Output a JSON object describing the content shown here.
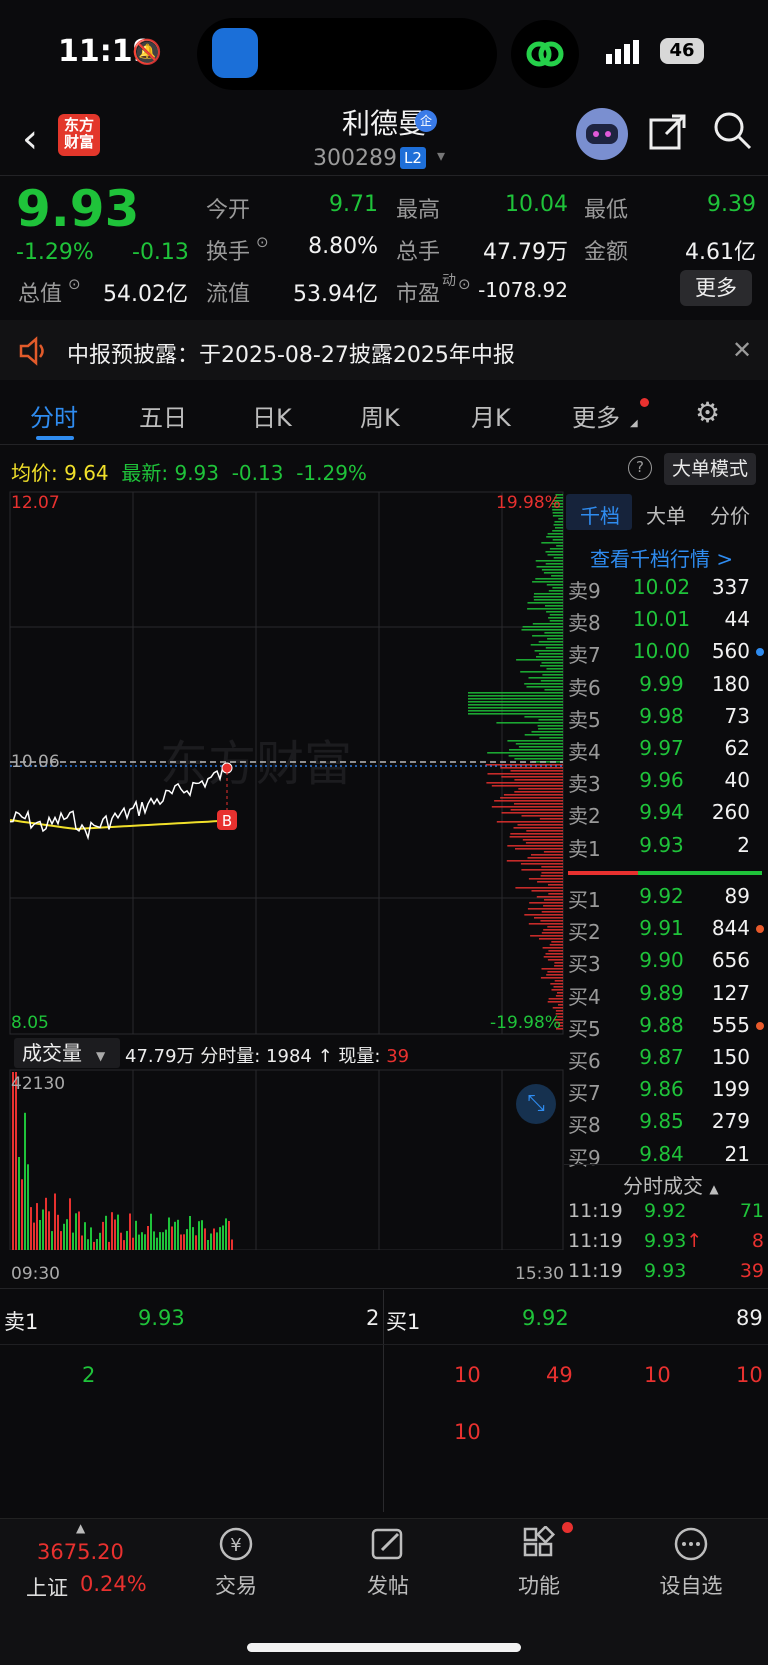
{
  "status_bar": {
    "time": "11:19",
    "battery": "46"
  },
  "header": {
    "logo_text": "东方财富",
    "stock_name": "利德曼",
    "enterprise_badge": "企",
    "stock_code": "300289",
    "level_badge": "L2"
  },
  "quote": {
    "price": "9.93",
    "change_pct": "-1.29%",
    "change": "-0.13",
    "fields": [
      {
        "label": "今开",
        "value": "9.71",
        "color": "green"
      },
      {
        "label": "最高",
        "value": "10.04",
        "color": "green"
      },
      {
        "label": "最低",
        "value": "9.39",
        "color": "green"
      },
      {
        "label": "换手",
        "value": "8.80%",
        "color": "white"
      },
      {
        "label": "总手",
        "value": "47.79万",
        "color": "white"
      },
      {
        "label": "金额",
        "value": "4.61亿",
        "color": "white"
      },
      {
        "label": "总值",
        "value": "54.02亿",
        "color": "white"
      },
      {
        "label": "流值",
        "value": "53.94亿",
        "color": "white"
      },
      {
        "label": "市盈",
        "label_sup": "动",
        "value": "-1078.92",
        "color": "white"
      }
    ],
    "more_button": "更多"
  },
  "notice": {
    "text": "中报预披露：于2025-08-27披露2025年中报"
  },
  "tabs": [
    "分时",
    "五日",
    "日K",
    "周K",
    "月K",
    "更多"
  ],
  "avg_row": {
    "avg_label": "均价:",
    "avg_value": "9.64",
    "latest_label": "最新:",
    "latest_value": "9.93",
    "latest_change": "-0.13",
    "latest_pct": "-1.29%",
    "help": "?",
    "big_order_button": "大单模式"
  },
  "chart": {
    "price_top": "12.07",
    "pct_top": "19.98%",
    "prev_close": "10.06",
    "price_bottom": "8.05",
    "pct_bottom": "-19.98%",
    "watermark": "东方财富",
    "buy_marker": "B",
    "volume_select": "成交量",
    "volume_info_total": "47.79万",
    "volume_info_label": "分时量: 1984 ↑ 现量:",
    "volume_info_now": "39",
    "volume_max": "42130",
    "time_start": "09:30",
    "time_end": "15:30",
    "colors": {
      "up": "#e8312f",
      "down": "#1fc33a",
      "avg": "#f1e02a",
      "price": "#ffffff"
    }
  },
  "orderbook": {
    "tabs": [
      "千档",
      "大单",
      "分价"
    ],
    "link": "查看千档行情 >",
    "asks": [
      {
        "label": "卖9",
        "price": "10.02",
        "vol": "337",
        "dot": ""
      },
      {
        "label": "卖8",
        "price": "10.01",
        "vol": "44",
        "dot": ""
      },
      {
        "label": "卖7",
        "price": "10.00",
        "vol": "560",
        "dot": "#2f8cf0"
      },
      {
        "label": "卖6",
        "price": "9.99",
        "vol": "180",
        "dot": ""
      },
      {
        "label": "卖5",
        "price": "9.98",
        "vol": "73",
        "dot": ""
      },
      {
        "label": "卖4",
        "price": "9.97",
        "vol": "62",
        "dot": ""
      },
      {
        "label": "卖3",
        "price": "9.96",
        "vol": "40",
        "dot": ""
      },
      {
        "label": "卖2",
        "price": "9.94",
        "vol": "260",
        "dot": ""
      },
      {
        "label": "卖1",
        "price": "9.93",
        "vol": "2",
        "dot": ""
      }
    ],
    "bids": [
      {
        "label": "买1",
        "price": "9.92",
        "vol": "89",
        "dot": ""
      },
      {
        "label": "买2",
        "price": "9.91",
        "vol": "844",
        "dot": "#e85a2b"
      },
      {
        "label": "买3",
        "price": "9.90",
        "vol": "656",
        "dot": ""
      },
      {
        "label": "买4",
        "price": "9.89",
        "vol": "127",
        "dot": ""
      },
      {
        "label": "买5",
        "price": "9.88",
        "vol": "555",
        "dot": "#e85a2b"
      },
      {
        "label": "买6",
        "price": "9.87",
        "vol": "150",
        "dot": ""
      },
      {
        "label": "买7",
        "price": "9.86",
        "vol": "199",
        "dot": ""
      },
      {
        "label": "买8",
        "price": "9.85",
        "vol": "279",
        "dot": ""
      },
      {
        "label": "买9",
        "price": "9.84",
        "vol": "21",
        "dot": ""
      }
    ],
    "trades_title": "分时成交",
    "trades": [
      {
        "time": "11:19",
        "price": "9.92",
        "arrow": "",
        "vol": "71",
        "vol_color": "green"
      },
      {
        "time": "11:19",
        "price": "9.93",
        "arrow": "↑",
        "vol": "8",
        "vol_color": "red"
      },
      {
        "time": "11:19",
        "price": "9.93",
        "arrow": "",
        "vol": "39",
        "vol_color": "red"
      }
    ]
  },
  "bottom_levels": {
    "sell_label": "卖1",
    "sell_price": "9.93",
    "sell_vol": "2",
    "buy_label": "买1",
    "buy_price": "9.92",
    "buy_vol": "89",
    "sell_queue": [
      "2"
    ],
    "buy_queue": [
      "10",
      "49",
      "10",
      "10",
      "10"
    ]
  },
  "tabbar": {
    "index_value": "3675.20",
    "index_name": "上证",
    "index_pct": "0.24%",
    "items": [
      "交易",
      "发帖",
      "功能",
      "设自选"
    ]
  }
}
